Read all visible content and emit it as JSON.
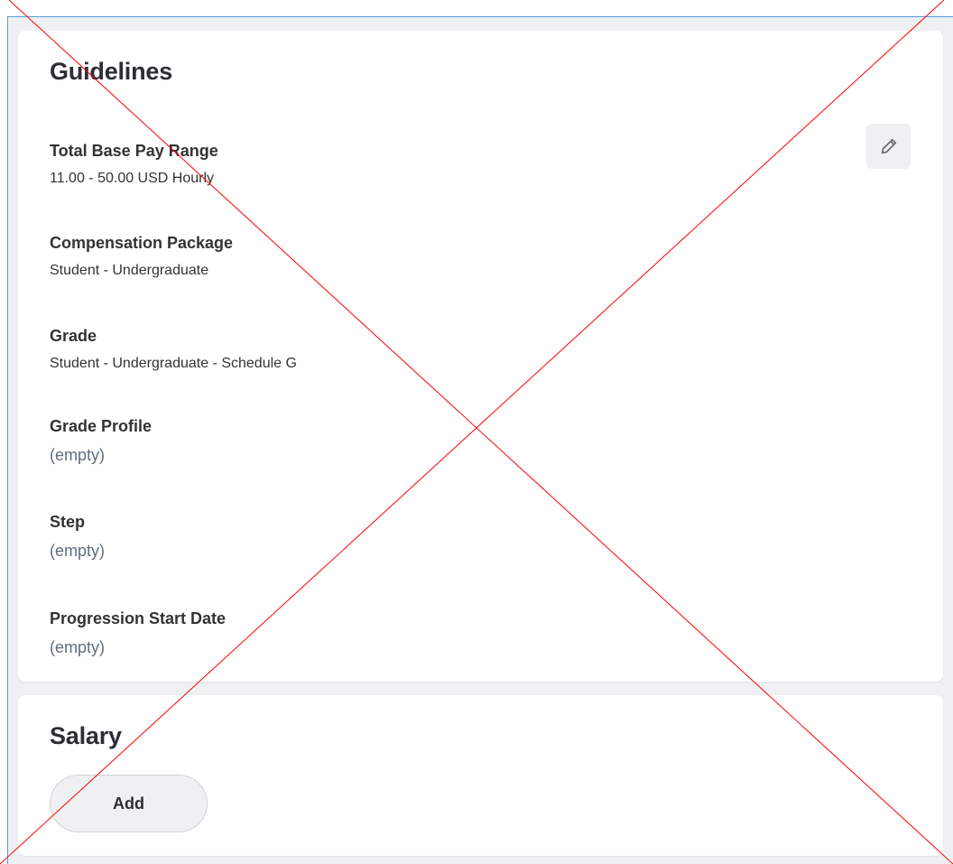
{
  "guidelines": {
    "title": "Guidelines",
    "edit_icon": "pencil-icon",
    "fields": [
      {
        "label": "Total Base Pay Range",
        "value": "11.00 - 50.00 USD Hourly"
      },
      {
        "label": "Compensation Package",
        "value": "Student - Undergraduate"
      },
      {
        "label": "Grade",
        "value": "Student - Undergraduate - Schedule G"
      },
      {
        "label": "Grade Profile",
        "value": "(empty)"
      },
      {
        "label": "Step",
        "value": "(empty)"
      },
      {
        "label": "Progression Start Date",
        "value": "(empty)"
      }
    ]
  },
  "salary": {
    "title": "Salary",
    "add_label": "Add"
  },
  "colors": {
    "frame_border": "#5b9bd5",
    "background": "#eef0f2",
    "card": "#ffffff",
    "empty_text": "#5f6e7d",
    "cross_lines": "#ff0000"
  }
}
